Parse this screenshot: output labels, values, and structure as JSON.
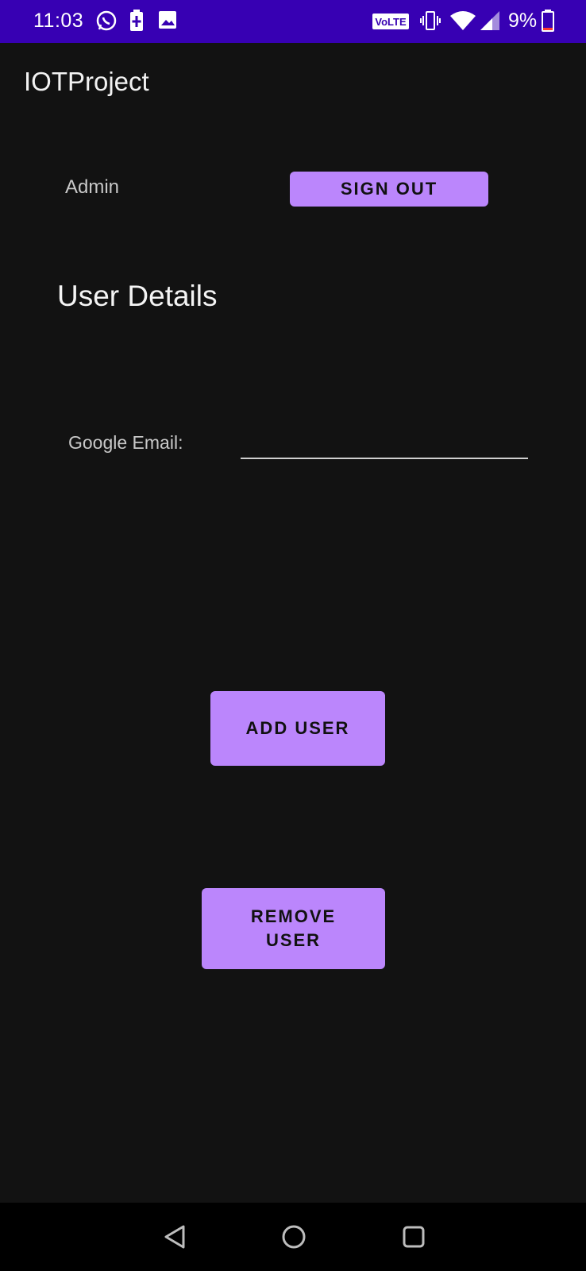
{
  "status_bar": {
    "time": "11:03",
    "volte": "VoLTE",
    "battery_percent": "9%",
    "icons": [
      "whatsapp-icon",
      "battery-saver-icon",
      "image-icon",
      "volte-icon",
      "vibrate-icon",
      "wifi-icon",
      "signal-icon",
      "battery-icon"
    ],
    "background_color": "#3700B3"
  },
  "app": {
    "title": "IOTProject"
  },
  "header": {
    "admin_label": "Admin",
    "sign_out_label": "SIGN OUT"
  },
  "main": {
    "section_title": "User Details",
    "email_label": "Google Email:",
    "email_value": "",
    "add_user_label": "ADD USER",
    "remove_user_label": "REMOVE USER"
  },
  "nav_bar": {
    "icons": [
      "back-icon",
      "home-icon",
      "recents-icon"
    ]
  },
  "colors": {
    "accent": "#BB86FC",
    "background": "#121212"
  }
}
